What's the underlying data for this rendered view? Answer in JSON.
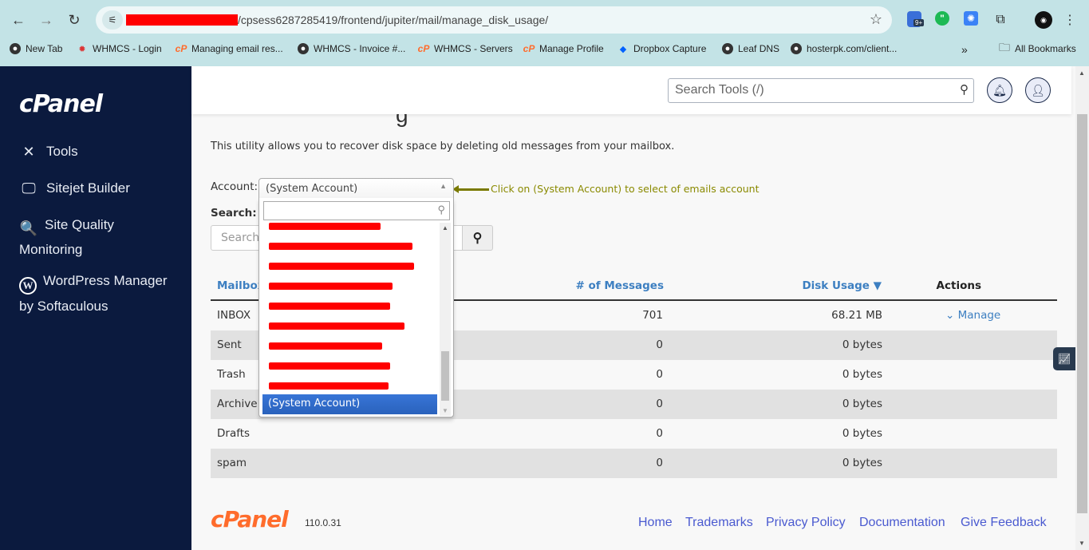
{
  "browser": {
    "url_visible": "/cpsess6287285419/frontend/jupiter/mail/manage_disk_usage/",
    "extension_badge": "9+",
    "bookmarks": [
      {
        "label": "New Tab",
        "icon": "globe-icon"
      },
      {
        "label": "WHMCS - Login",
        "icon": "whmcs-icon"
      },
      {
        "label": "Managing email res...",
        "icon": "cpanel-icon"
      },
      {
        "label": "WHMCS - Invoice #...",
        "icon": "globe-icon"
      },
      {
        "label": "WHMCS - Servers",
        "icon": "cpanel-icon"
      },
      {
        "label": "Manage Profile",
        "icon": "cpanel-icon"
      },
      {
        "label": "Dropbox Capture",
        "icon": "dropbox-icon"
      },
      {
        "label": "Leaf DNS",
        "icon": "globe-icon"
      },
      {
        "label": "hosterpk.com/client...",
        "icon": "globe-icon"
      }
    ],
    "more_bookmarks": "»",
    "all_bookmarks": "All Bookmarks"
  },
  "sidebar": {
    "logo": "cPanel",
    "items": [
      {
        "label": "Tools",
        "icon": "tools-icon"
      },
      {
        "label": "Sitejet Builder",
        "icon": "sitejet-icon"
      },
      {
        "label": "Site Quality Monitoring",
        "icon": "site-quality-icon"
      },
      {
        "label": "WordPress Manager by Softaculous",
        "icon": "wordpress-icon"
      }
    ]
  },
  "header": {
    "search_placeholder": "Search Tools (/)"
  },
  "page": {
    "title_fragment": "g",
    "description": "This utility allows you to recover disk space by deleting old messages from your mailbox.",
    "account_label": "Account:",
    "search_label": "Search:",
    "search_placeholder": "Search",
    "annotation": "Click on (System Account) to select of emails account"
  },
  "account_dropdown": {
    "selected": "(System Account)",
    "options": [
      {
        "label": "[redacted]",
        "redacted": true
      },
      {
        "label": "[redacted]",
        "redacted": true
      },
      {
        "label": "[redacted]",
        "redacted": true
      },
      {
        "label": "[redacted]",
        "redacted": true
      },
      {
        "label": "[redacted]",
        "redacted": true
      },
      {
        "label": "[redacted]",
        "redacted": true
      },
      {
        "label": "[redacted]",
        "redacted": true
      },
      {
        "label": "[redacted]",
        "redacted": true
      },
      {
        "label": "[redacted]",
        "redacted": true
      },
      {
        "label": "(System Account)",
        "redacted": false,
        "selected": true
      }
    ]
  },
  "table": {
    "headers": {
      "mailbox": "Mailbox",
      "messages": "# of Messages",
      "disk_usage": "Disk Usage ▼",
      "actions": "Actions"
    },
    "rows": [
      {
        "mailbox": "INBOX",
        "messages": "701",
        "disk_usage": "68.21 MB",
        "action": "Manage"
      },
      {
        "mailbox": "Sent",
        "messages": "0",
        "disk_usage": "0 bytes",
        "action": ""
      },
      {
        "mailbox": "Trash",
        "messages": "0",
        "disk_usage": "0 bytes",
        "action": ""
      },
      {
        "mailbox": "Archive",
        "messages": "0",
        "disk_usage": "0 bytes",
        "action": ""
      },
      {
        "mailbox": "Drafts",
        "messages": "0",
        "disk_usage": "0 bytes",
        "action": ""
      },
      {
        "mailbox": "spam",
        "messages": "0",
        "disk_usage": "0 bytes",
        "action": ""
      }
    ]
  },
  "footer": {
    "logo": "cPanel",
    "version": "110.0.31",
    "links": [
      "Home",
      "Trademarks",
      "Privacy Policy",
      "Documentation",
      "Give Feedback"
    ]
  },
  "colors": {
    "sidebar_bg": "#0b1a3e",
    "link": "#3d7fc1",
    "footer_link": "#4a5ad0",
    "brand_orange": "#ff6c2c",
    "selected_option": "#3875d7",
    "annotation": "#8a8a00"
  }
}
